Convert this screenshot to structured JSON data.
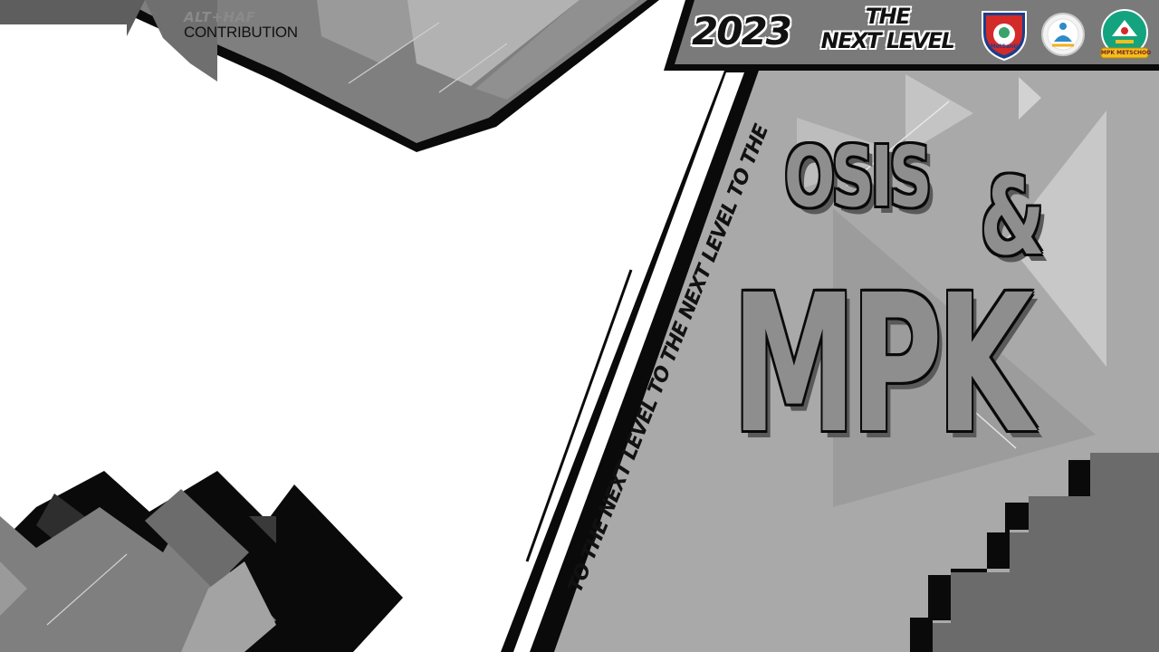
{
  "credit": {
    "line1": "ALT+HAF",
    "line2": "CONTRIBUTION"
  },
  "header": {
    "year": "2023",
    "tagline_line1": "THE",
    "tagline_line2": "NEXT LEVEL",
    "logos": [
      {
        "name": "shield-logo",
        "label": "MetSanti"
      },
      {
        "name": "osis-logo",
        "label": ""
      },
      {
        "name": "mpk-logo",
        "label": "MPK METSCHOO"
      }
    ]
  },
  "ticker": {
    "text": "TO THE NEXT LEVEL TO THE NEXT LEVEL TO THE NE"
  },
  "title": {
    "line1": "OSIS",
    "ampersand": "&",
    "line2": "MPK"
  },
  "colors": {
    "background": "#ffffff",
    "panel": "#a8a8a8",
    "dark": "#0a0a0a",
    "mid": "#777777",
    "light": "#d6d6d6"
  }
}
